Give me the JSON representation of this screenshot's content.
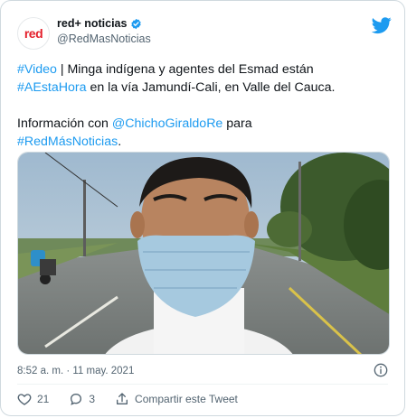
{
  "account": {
    "display_name": "red+ noticias",
    "handle": "@RedMasNoticias",
    "avatar_text": "red"
  },
  "tweet": {
    "line1_hashtag": "#Video",
    "line1_text": " | Minga indígena y agentes del Esmad están",
    "line2_hashtag": "#AEstaHora",
    "line2_text": " en la vía Jamundí-Cali, en Valle del Cauca.",
    "line3_text": "Información con ",
    "line3_mention": "@ChichoGiraldoRe",
    "line3_text2": " para",
    "line4_hashtag": "#RedMásNoticias",
    "line4_text": "."
  },
  "meta": {
    "timestamp": "8:52 a. m. · 11 may. 2021"
  },
  "actions": {
    "likes": "21",
    "replies": "3",
    "share_label": "Compartir este Tweet"
  },
  "colors": {
    "accent": "#1d9bf0",
    "brand_red": "#e4202c"
  }
}
